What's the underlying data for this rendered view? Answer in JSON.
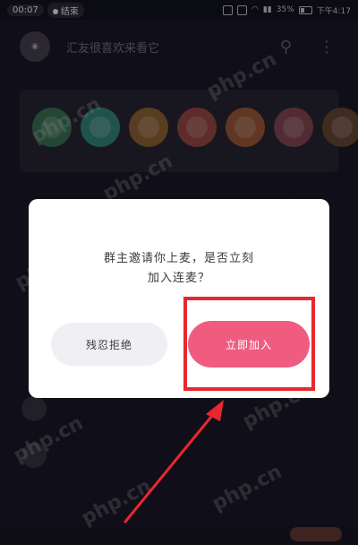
{
  "status_bar": {
    "time_badge": "00:07",
    "end_badge": "结束",
    "battery": "35%",
    "clock": "下午4:17"
  },
  "room": {
    "title": "汇友很喜欢来看它"
  },
  "dialog": {
    "message_line1": "群主邀请你上麦，是否立刻",
    "message_line2": "加入连麦？",
    "decline_label": "残忍拒绝",
    "join_label": "立即加入"
  },
  "watermark": "php.cn",
  "colors": {
    "join_button": "#ef5c80",
    "decline_button": "#efeff4",
    "highlight": "#e8272e",
    "background": "#1d1b2b"
  },
  "icons": [
    "search-icon",
    "more-icon",
    "wifi-icon",
    "battery-icon"
  ]
}
